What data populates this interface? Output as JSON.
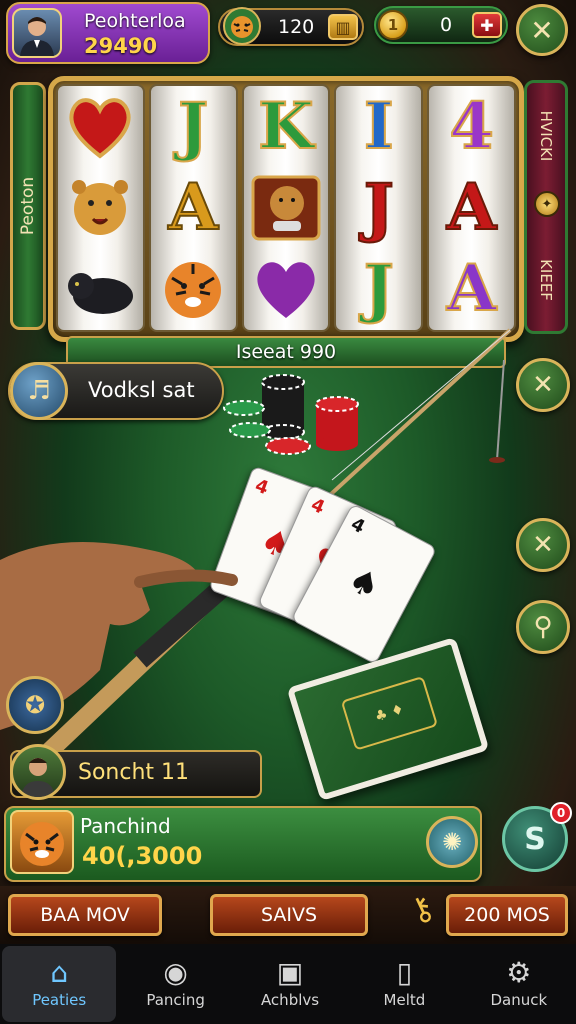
{
  "top_bar": {
    "player_name": "Peohterloa",
    "player_score": "29490",
    "center_value": "120",
    "coin_value": "0",
    "coin_glyph": "1"
  },
  "slot": {
    "left_label": "Peoton",
    "right_top_label": "HVICKI",
    "right_bottom_label": "KIEEF",
    "bet_label": "Iseeat 990",
    "reels": [
      [
        "heart",
        "lioness",
        "panther"
      ],
      [
        "J",
        "A",
        "tiger"
      ],
      [
        "K",
        "cougar",
        "heart"
      ],
      [
        "I",
        "J",
        "J"
      ],
      [
        "4",
        "A",
        "A"
      ]
    ]
  },
  "chat": {
    "text": "Vodksl sat"
  },
  "friend": {
    "name": "Soncht 11"
  },
  "reward": {
    "title": "Panchind",
    "amount": "40(,3000"
  },
  "badge_count": "0",
  "actions": {
    "left": "BAA MOV",
    "center": "SAIVS",
    "right": "200 MOS"
  },
  "nav": [
    {
      "label": "Peaties",
      "icon": "home-icon",
      "glyph": "⌂"
    },
    {
      "label": "Pancing",
      "icon": "game-icon",
      "glyph": "◉"
    },
    {
      "label": "Achblvs",
      "icon": "achievements-icon",
      "glyph": "▣"
    },
    {
      "label": "Meltd",
      "icon": "mobile-icon",
      "glyph": "▯"
    },
    {
      "label": "Danuck",
      "icon": "settings-icon",
      "glyph": "⚙"
    }
  ],
  "colors": {
    "accent_gold": "#d9b45a",
    "felt_green": "#2e7a3a",
    "purple": "#8a36b8",
    "nav_active": "#6fc7ff"
  }
}
